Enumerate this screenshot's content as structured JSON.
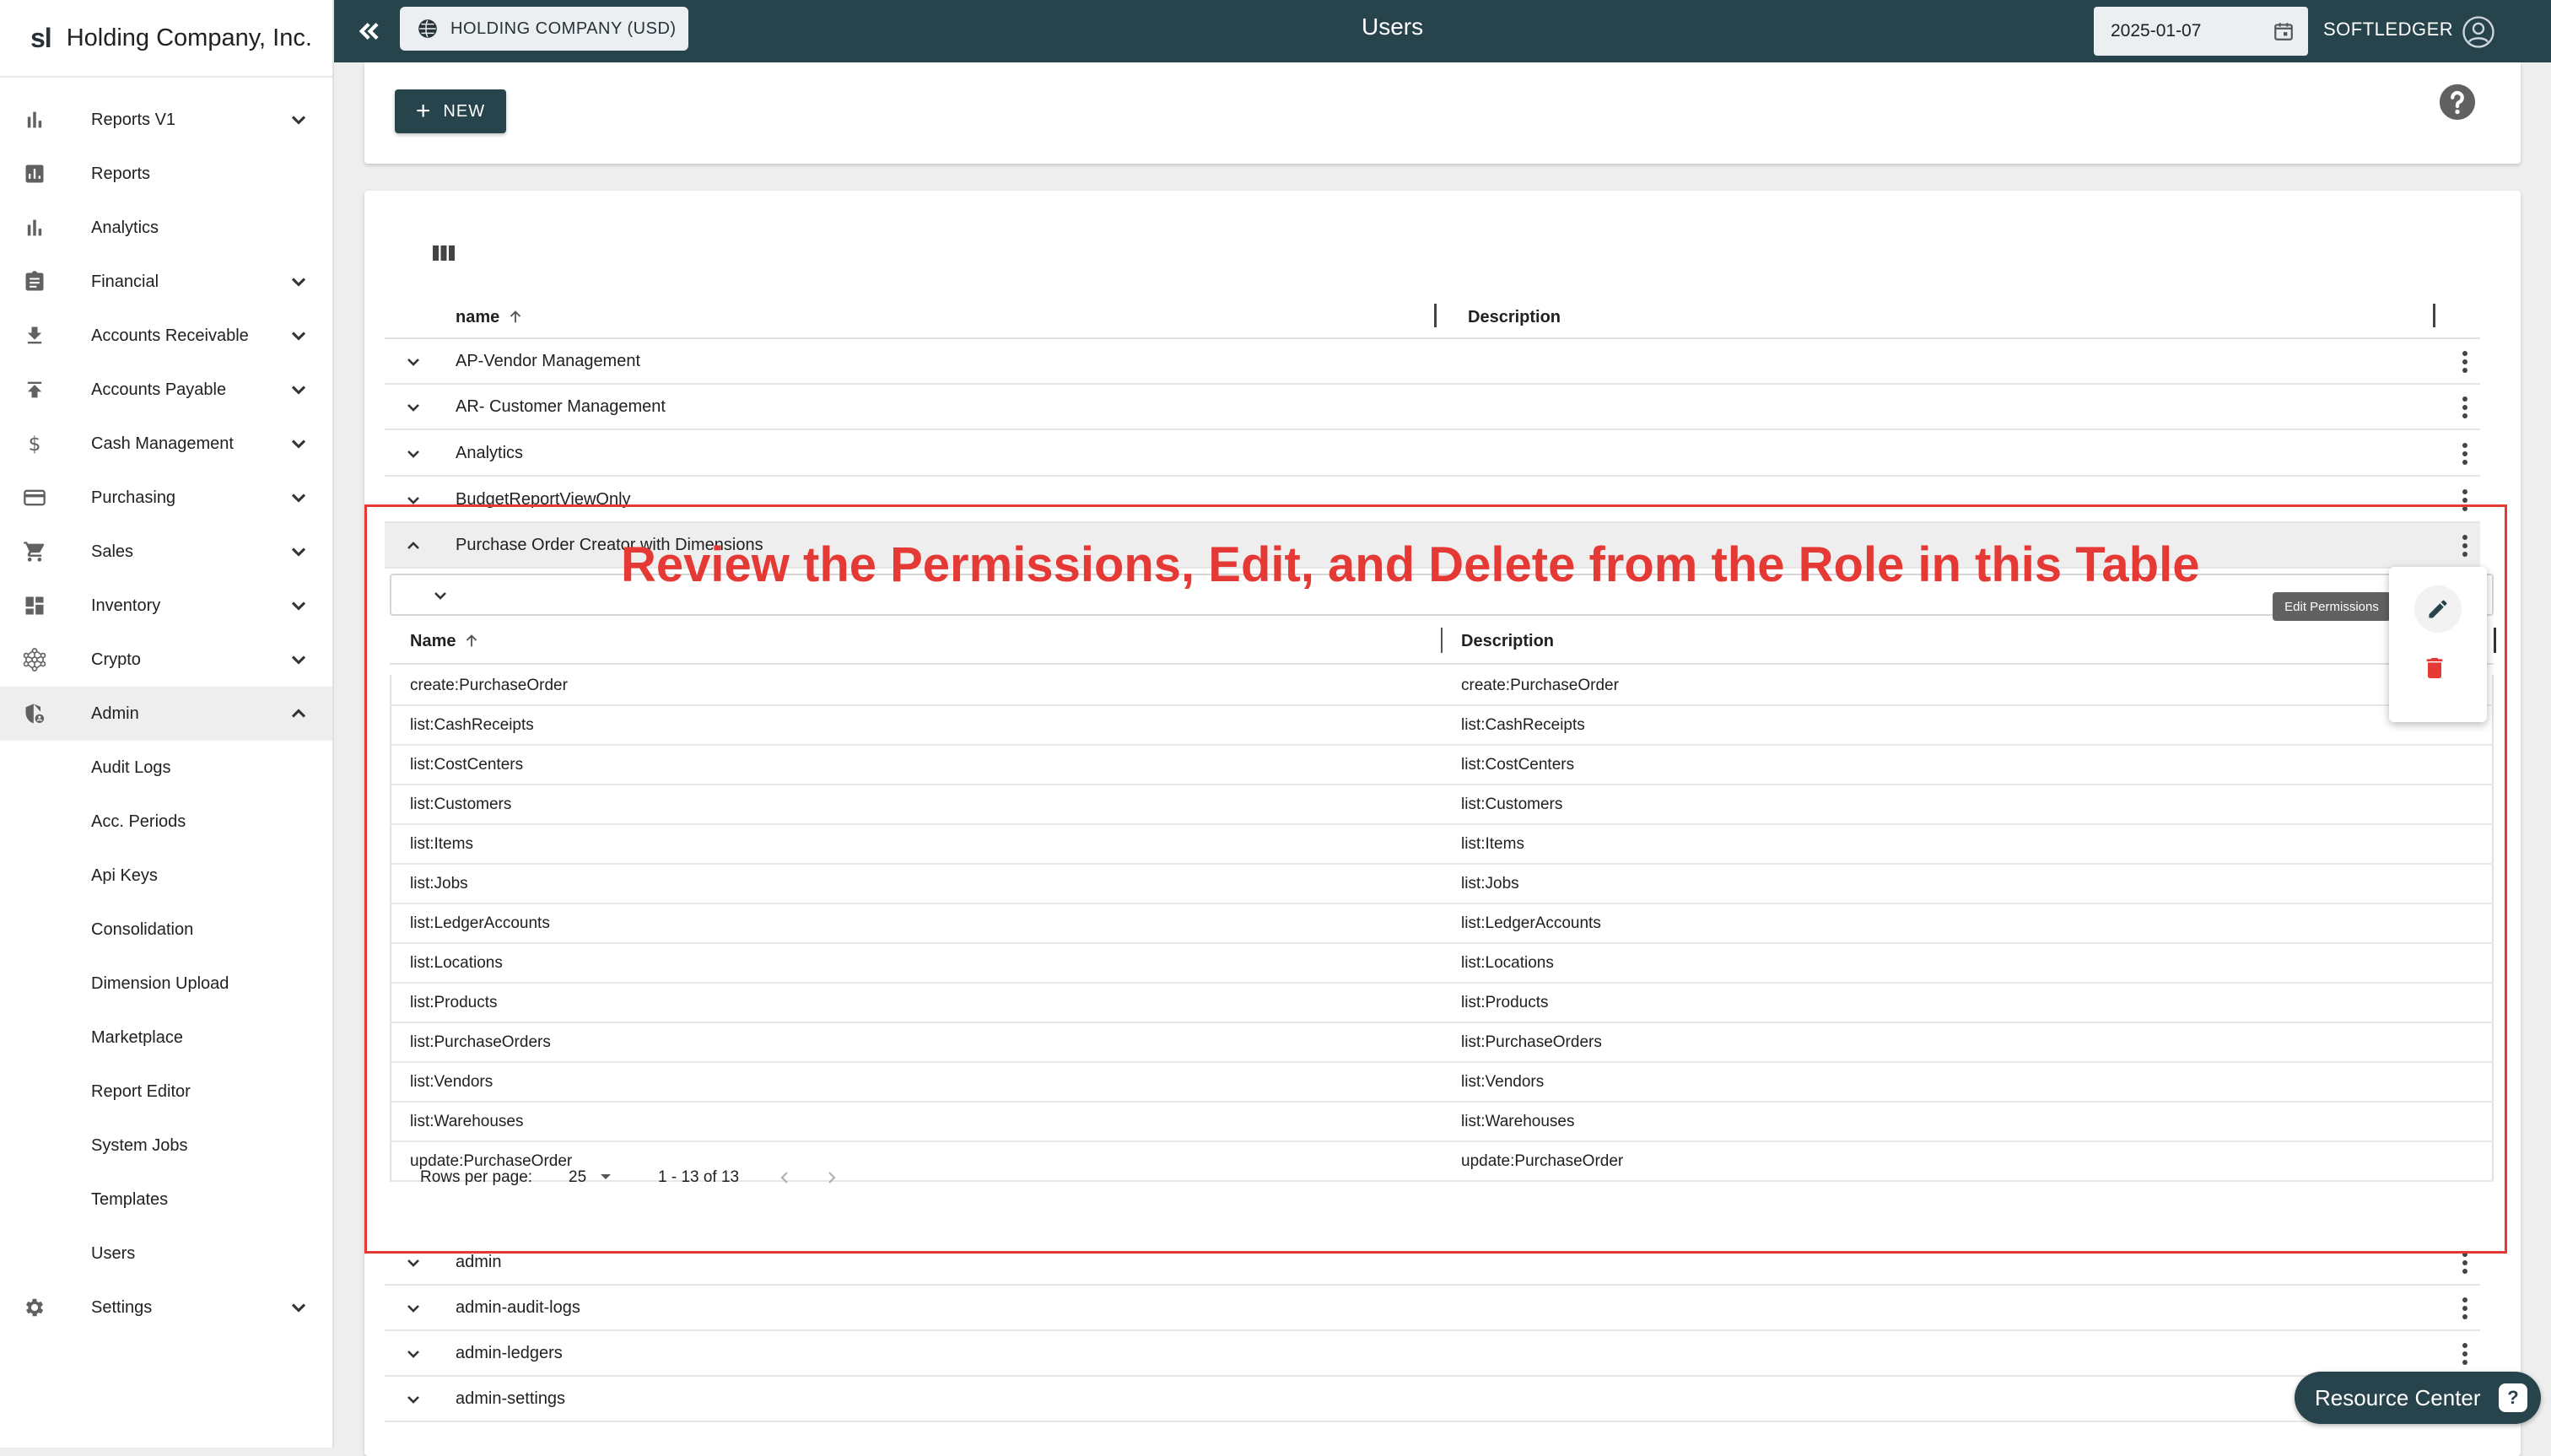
{
  "brand": {
    "logo": "sl",
    "name": "Holding Company, Inc."
  },
  "sidebar": {
    "items": [
      {
        "label": "Reports V1",
        "icon": "bar-chart-icon",
        "expandable": true
      },
      {
        "label": "Reports",
        "icon": "report-icon",
        "expandable": false
      },
      {
        "label": "Analytics",
        "icon": "analytics-icon",
        "expandable": false
      },
      {
        "label": "Financial",
        "icon": "clipboard-icon",
        "expandable": true
      },
      {
        "label": "Accounts Receivable",
        "icon": "download-icon",
        "expandable": true
      },
      {
        "label": "Accounts Payable",
        "icon": "upload-icon",
        "expandable": true
      },
      {
        "label": "Cash Management",
        "icon": "dollar-icon",
        "expandable": true
      },
      {
        "label": "Purchasing",
        "icon": "credit-card-icon",
        "expandable": true
      },
      {
        "label": "Sales",
        "icon": "cart-icon",
        "expandable": true
      },
      {
        "label": "Inventory",
        "icon": "dashboard-icon",
        "expandable": true
      },
      {
        "label": "Crypto",
        "icon": "network-icon",
        "expandable": true
      },
      {
        "label": "Admin",
        "icon": "admin-shield-icon",
        "expandable": true
      }
    ],
    "admin_sub": [
      "Audit Logs",
      "Acc. Periods",
      "Api Keys",
      "Consolidation",
      "Dimension Upload",
      "Marketplace",
      "Report Editor",
      "System Jobs",
      "Templates",
      "Users"
    ],
    "settings": {
      "label": "Settings",
      "icon": "gear-icon"
    }
  },
  "topbar": {
    "company": "HOLDING COMPANY (USD)",
    "title": "Users",
    "date": "2025-01-07",
    "user": "SOFTLEDGER"
  },
  "toolbar": {
    "new_label": "NEW"
  },
  "roles_table": {
    "headers": {
      "name": "name",
      "description": "Description"
    },
    "rows_before": [
      "AP-Vendor Management",
      "AR- Customer Management",
      "Analytics",
      "BudgetReportViewOnly"
    ],
    "expanded_row": "Purchase Order Creator with Dimensions",
    "rows_after": [
      "admin",
      "admin-audit-logs",
      "admin-ledgers",
      "admin-settings"
    ]
  },
  "permissions_table": {
    "headers": {
      "name": "Name",
      "description": "Description"
    },
    "rows": [
      {
        "name": "create:PurchaseOrder",
        "description": "create:PurchaseOrder"
      },
      {
        "name": "list:CashReceipts",
        "description": "list:CashReceipts"
      },
      {
        "name": "list:CostCenters",
        "description": "list:CostCenters"
      },
      {
        "name": "list:Customers",
        "description": "list:Customers"
      },
      {
        "name": "list:Items",
        "description": "list:Items"
      },
      {
        "name": "list:Jobs",
        "description": "list:Jobs"
      },
      {
        "name": "list:LedgerAccounts",
        "description": "list:LedgerAccounts"
      },
      {
        "name": "list:Locations",
        "description": "list:Locations"
      },
      {
        "name": "list:Products",
        "description": "list:Products"
      },
      {
        "name": "list:PurchaseOrders",
        "description": "list:PurchaseOrders"
      },
      {
        "name": "list:Vendors",
        "description": "list:Vendors"
      },
      {
        "name": "list:Warehouses",
        "description": "list:Warehouses"
      },
      {
        "name": "update:PurchaseOrder",
        "description": "update:PurchaseOrder"
      }
    ],
    "pagination": {
      "rows_per_page_label": "Rows per page:",
      "rows_per_page": "25",
      "range": "1 - 13 of 13"
    }
  },
  "row_menu": {
    "tooltip": "Edit Permissions",
    "edit_icon": "pencil-icon",
    "delete_icon": "trash-icon"
  },
  "annotation": "Review the Permissions, Edit, and Delete from the Role in this Table",
  "resource_center": {
    "label": "Resource Center"
  },
  "colors": {
    "primary": "#27434c",
    "annotation": "#e53935",
    "delete": "#e53935"
  }
}
